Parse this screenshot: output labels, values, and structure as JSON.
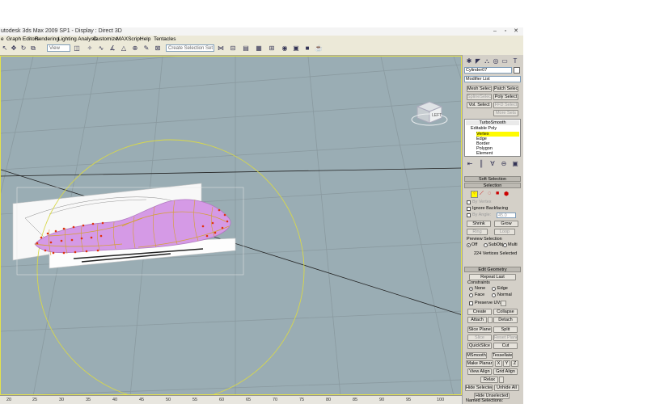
{
  "window": {
    "title": "utodesk 3ds Max 2009 SP1      - Display : Direct 3D",
    "minimize": "–",
    "restore": "▫",
    "close": "✕"
  },
  "menu": [
    "e",
    "Graph Editors",
    "Rendering",
    "Lighting Analysis",
    "Customize",
    "MAXScript",
    "Help",
    "Tentacles"
  ],
  "toolbar": {
    "reference_coord": "View",
    "named_selection_placeholder": "Create Selection Set"
  },
  "viewport": {
    "viewcube_label": "LEFT",
    "colors": {
      "background": "#9aadb4",
      "border": "#e5e24a",
      "mesh": "#d59ae6",
      "vertex": "#e03010",
      "gizmo": "#d8d84a"
    }
  },
  "ruler": {
    "ticks": [
      "20",
      "25",
      "30",
      "35",
      "40",
      "45",
      "50",
      "55",
      "60",
      "65",
      "70",
      "75",
      "80",
      "85",
      "90",
      "95",
      "100"
    ]
  },
  "command_panel": {
    "object_name": "Cylinder07",
    "modifier_list": "Modifier List",
    "mod_buttons": {
      "mesh_select": "Mesh Select",
      "patch_select": "Patch Select",
      "spline_select": "SplineSelect",
      "poly_select": "Poly Select",
      "vol_select": "Vol. Select",
      "ffd_select": "FFD Select",
      "more_sets": "More Sets"
    },
    "stack": {
      "turbosmooth": "TurboSmooth",
      "editable_poly": "Editable Poly",
      "vertex": "Vertex",
      "edge": "Edge",
      "border": "Border",
      "polygon": "Polygon",
      "element": "Element"
    },
    "soft_selection": "Soft Selection",
    "selection": {
      "title": "Selection",
      "by_vertex": "By Vertex",
      "ignore_backfacing": "Ignore Backfacing",
      "by_angle": "By Angle:",
      "angle_value": "45.0",
      "shrink": "Shrink",
      "grow": "Grow",
      "ring": "Ring",
      "loop": "Loop",
      "preview_title": "Preview Selection",
      "preview_off": "Off",
      "preview_subobj": "SubObj",
      "preview_multi": "Multi",
      "status": "224 Vertices Selected"
    },
    "edit_geometry": {
      "title": "Edit Geometry",
      "repeat_last": "Repeat Last",
      "constraints": "Constraints",
      "none": "None",
      "edge": "Edge",
      "face": "Face",
      "normal": "Normal",
      "preserve_uvs": "Preserve UVs",
      "create": "Create",
      "collapse": "Collapse",
      "attach": "Attach",
      "detach": "Detach",
      "slice_plane": "Slice Plane",
      "split": "Split",
      "slice": "Slice",
      "reset_plane": "Reset Plane",
      "quickslice": "QuickSlice",
      "cut": "Cut",
      "msmooth": "MSmooth",
      "tessellate": "Tessellate",
      "make_planar": "Make Planar",
      "x": "X",
      "y": "Y",
      "z": "Z",
      "view_align": "View Align",
      "grid_align": "Grid Align",
      "relax": "Relax",
      "hide_selected": "Hide Selected",
      "unhide_all": "Unhide All",
      "hide_unselected": "Hide Unselected",
      "named_selections": "Named Selections:"
    }
  }
}
